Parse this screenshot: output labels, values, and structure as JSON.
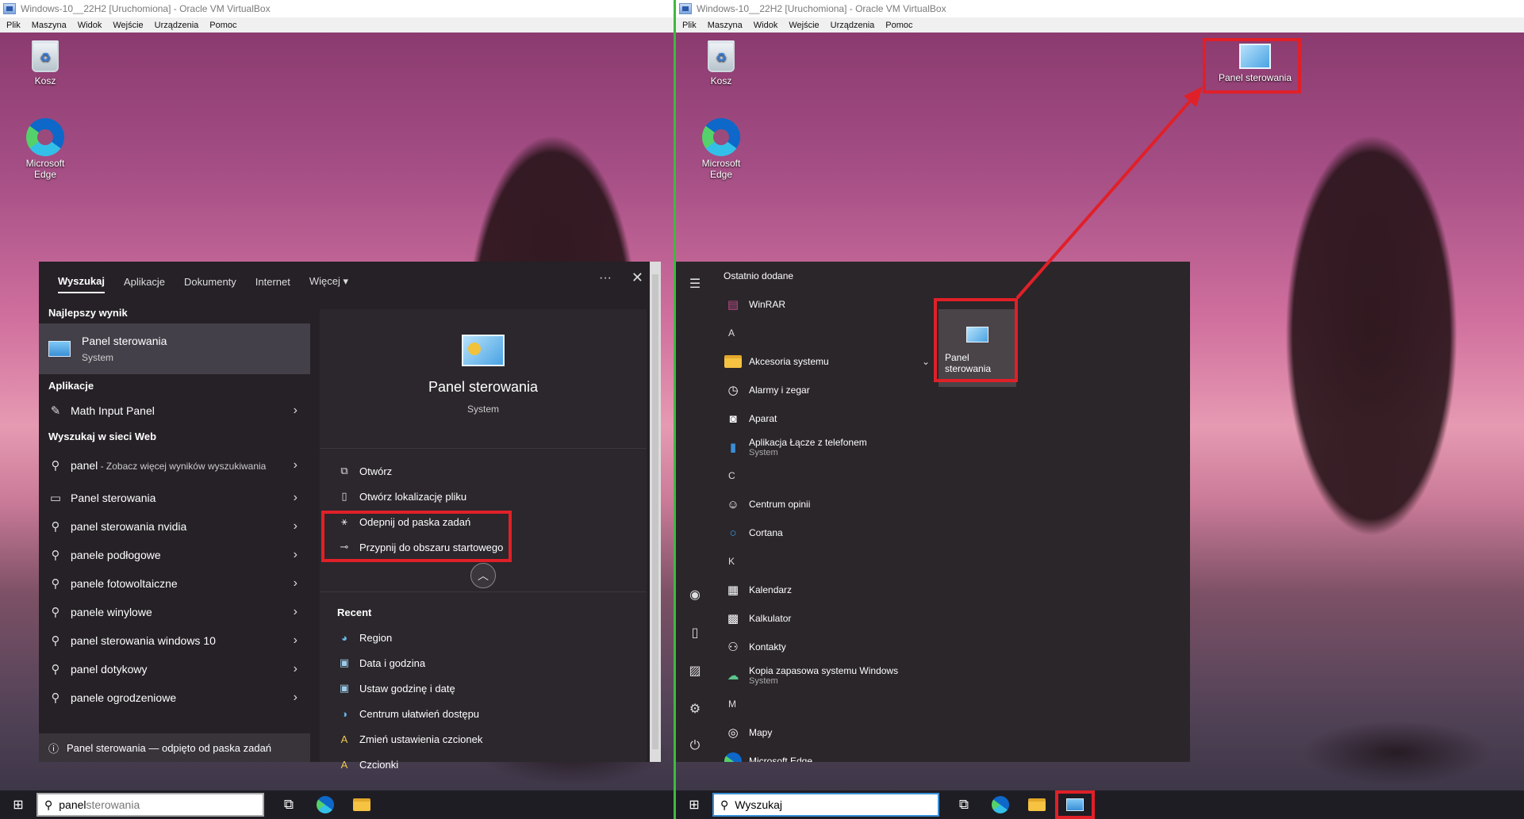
{
  "left": {
    "window_title": "Windows-10__22H2 [Uruchomiona] - Oracle VM VirtualBox",
    "menu": [
      "Plik",
      "Maszyna",
      "Widok",
      "Wejście",
      "Urządzenia",
      "Pomoc"
    ],
    "desktop_icons": [
      "Kosz",
      "Microsoft Edge"
    ],
    "tabs": [
      "Wyszukaj",
      "Aplikacje",
      "Dokumenty",
      "Internet",
      "Więcej"
    ],
    "tab_more_dots": "···",
    "best_result_heading": "Najlepszy wynik",
    "best_result": {
      "title": "Panel sterowania",
      "subtitle": "System"
    },
    "apps_heading": "Aplikacje",
    "apps": [
      "Math Input Panel"
    ],
    "web_heading": "Wyszukaj w sieci Web",
    "web_first": {
      "title": "panel",
      "hint": " - Zobacz więcej wyników wyszukiwania"
    },
    "web_items": [
      "Panel sterowania",
      "panel sterowania nvidia",
      "panele podłogowe",
      "panele fotowoltaiczne",
      "panele winylowe",
      "panel sterowania windows 10",
      "panel dotykowy",
      "panele ogrodzeniowe"
    ],
    "info": "Panel sterowania — odpięto od paska zadań",
    "preview": {
      "title": "Panel sterowania",
      "subtitle": "System"
    },
    "actions": [
      "Otwórz",
      "Otwórz lokalizację pliku",
      "Odepnij od paska zadań",
      "Przypnij do obszaru startowego"
    ],
    "recent_heading": "Recent",
    "recent": [
      "Region",
      "Data i godzina",
      "Ustaw godzinę i datę",
      "Centrum ułatwień dostępu",
      "Zmień ustawienia czcionek",
      "Czcionki"
    ],
    "search_value": "panel",
    "search_rest": " sterowania"
  },
  "right": {
    "window_title": "Windows-10__22H2 [Uruchomiona] - Oracle VM VirtualBox",
    "menu": [
      "Plik",
      "Maszyna",
      "Widok",
      "Wejście",
      "Urządzenia",
      "Pomoc"
    ],
    "desktop_icons": [
      "Kosz",
      "Microsoft Edge",
      "Panel sterowania"
    ],
    "recently_added": "Ostatnio dodane",
    "apps": [
      {
        "kind": "app",
        "label": "WinRAR",
        "icon": "winrar-icon"
      },
      {
        "kind": "letter",
        "label": "A"
      },
      {
        "kind": "app",
        "label": "Akcesoria systemu",
        "icon": "folder-icon",
        "expand": "⌄"
      },
      {
        "kind": "app",
        "label": "Alarmy i zegar",
        "icon": "clock-icon"
      },
      {
        "kind": "app",
        "label": "Aparat",
        "icon": "camera-icon"
      },
      {
        "kind": "app",
        "label": "Aplikacja Łącze z telefonem",
        "sub": "System",
        "icon": "phone-link-icon"
      },
      {
        "kind": "letter",
        "label": "C"
      },
      {
        "kind": "app",
        "label": "Centrum opinii",
        "icon": "feedback-icon"
      },
      {
        "kind": "app",
        "label": "Cortana",
        "icon": "cortana-icon"
      },
      {
        "kind": "letter",
        "label": "K"
      },
      {
        "kind": "app",
        "label": "Kalendarz",
        "icon": "calendar-icon"
      },
      {
        "kind": "app",
        "label": "Kalkulator",
        "icon": "calculator-icon"
      },
      {
        "kind": "app",
        "label": "Kontakty",
        "icon": "contacts-icon"
      },
      {
        "kind": "app",
        "label": "Kopia zapasowa systemu Windows",
        "sub": "System",
        "icon": "backup-icon"
      },
      {
        "kind": "letter",
        "label": "M"
      },
      {
        "kind": "app",
        "label": "Mapy",
        "icon": "maps-icon"
      },
      {
        "kind": "app",
        "label": "Microsoft Edge",
        "icon": "edge-icon"
      }
    ],
    "tile_label": "Panel sterowania",
    "search_placeholder": "Wyszukaj"
  },
  "colors": {
    "highlight_red": "#e02028",
    "divider_green": "#3fb93f",
    "panel_dark": "#252126"
  }
}
